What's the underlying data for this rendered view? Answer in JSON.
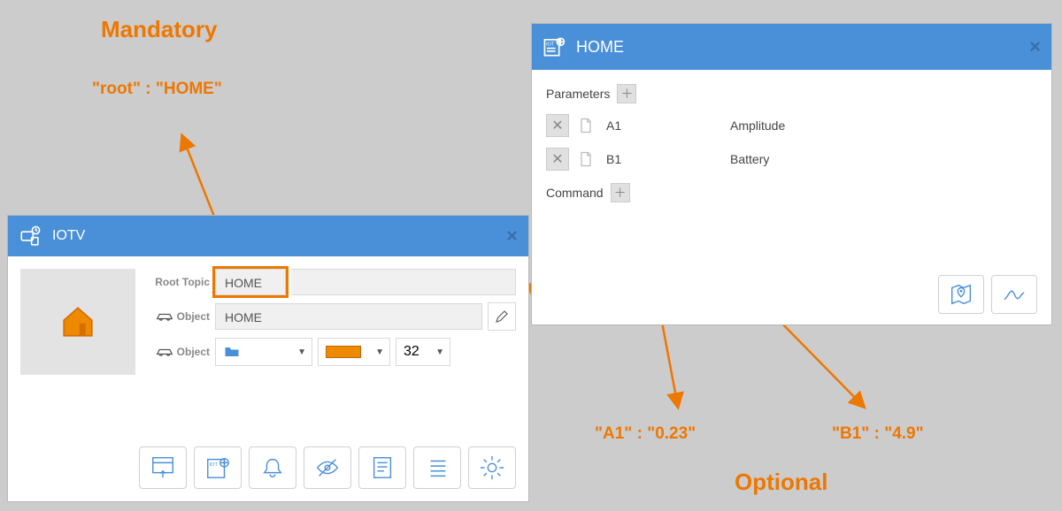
{
  "annotations": {
    "mandatory_title": "Mandatory",
    "root_text": "\"root\" : \"HOME\"",
    "a1_text": "\"A1\" : \"0.23\"",
    "b1_text": "\"B1\" : \"4.9\"",
    "optional_title": "Optional"
  },
  "iotv": {
    "title": "IOTV",
    "root_label": "Root Topic",
    "root_value": "HOME",
    "object_label": "Object",
    "object_value": "HOME",
    "object2_label": "Object",
    "size_value": "32"
  },
  "home": {
    "title": "HOME",
    "parameters_label": "Parameters",
    "params": [
      {
        "key": "A1",
        "value": "Amplitude"
      },
      {
        "key": "B1",
        "value": "Battery"
      }
    ],
    "command_label": "Command"
  },
  "colors": {
    "accent": "#4a90d9",
    "orange": "#ee7700"
  }
}
